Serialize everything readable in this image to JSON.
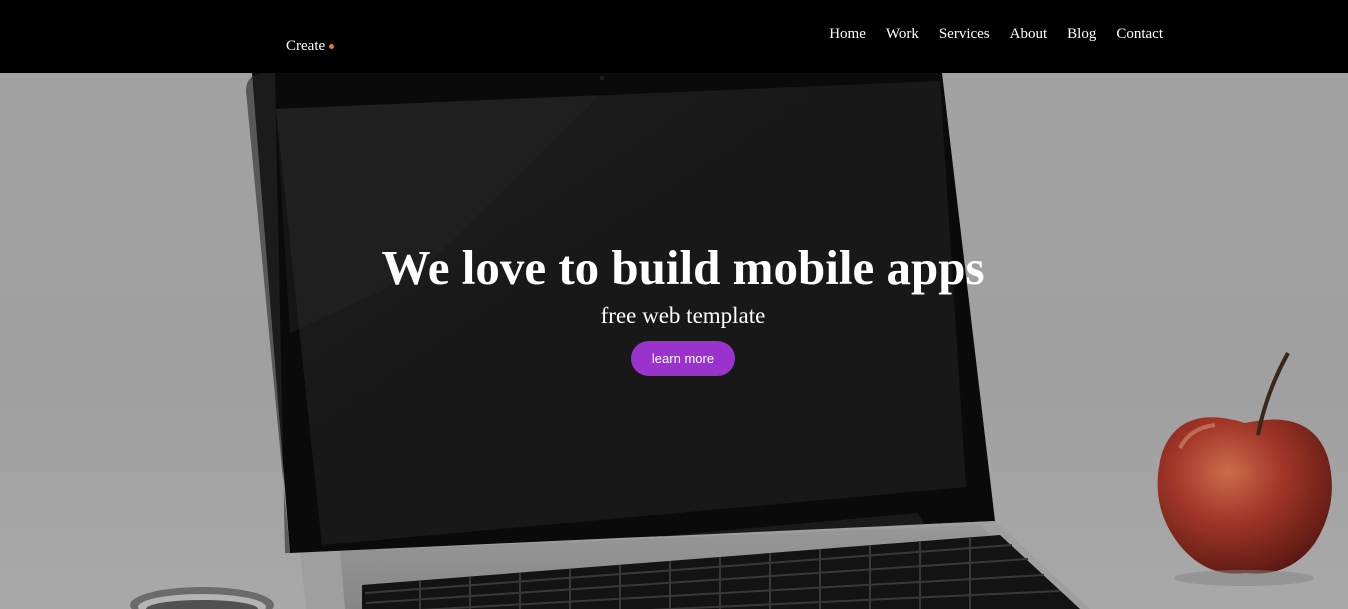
{
  "navbar": {
    "brand": "Create",
    "brand_dot_color": "#e8792f",
    "links": [
      {
        "label": "Home"
      },
      {
        "label": "Work"
      },
      {
        "label": "Services"
      },
      {
        "label": "About"
      },
      {
        "label": "Blog"
      },
      {
        "label": "Contact"
      }
    ]
  },
  "hero": {
    "title": "We love to build mobile apps",
    "subtitle": "free web template",
    "button_label": "learn more",
    "button_color": "#9933cc",
    "background_image": "laptop-and-apple-photo"
  }
}
